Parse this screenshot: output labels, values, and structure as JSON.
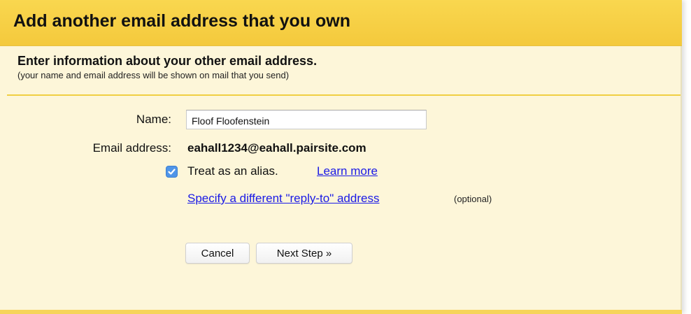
{
  "dialog": {
    "title": "Add another email address that you own",
    "section_heading": "Enter information about your other email address.",
    "section_subtext": "(your name and email address will be shown on mail that you send)"
  },
  "form": {
    "name_label": "Name:",
    "name_value": "Floof Floofenstein",
    "email_label": "Email address:",
    "email_value": "eahall1234@eahall.pairsite.com",
    "alias_checked": true,
    "alias_label": "Treat as an alias.",
    "learn_more_link": "Learn more",
    "reply_to_link": "Specify a different \"reply-to\" address",
    "optional_note": "(optional)"
  },
  "buttons": {
    "cancel_label": "Cancel",
    "next_label": "Next Step »"
  },
  "colors": {
    "header_bg": "#f6d04a",
    "panel_bg": "#fdf6d9",
    "divider": "#f0cf42",
    "link": "#1a1ae6",
    "checkbox": "#4f95e8"
  }
}
